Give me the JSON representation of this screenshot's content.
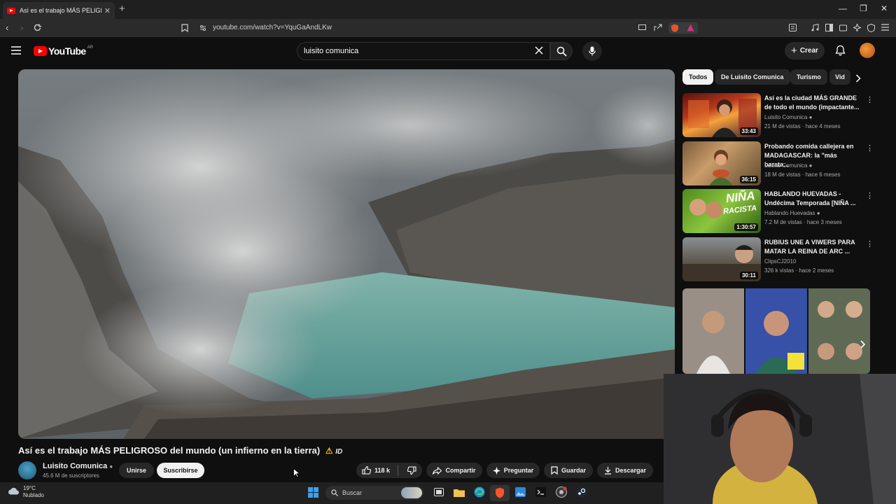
{
  "browser": {
    "tab_title": "Así es el trabajo MÁS PELIGR",
    "url": "youtube.com/watch?v=YquGaAndLKw"
  },
  "youtube": {
    "logo_text": "YouTube",
    "country_code": "AR",
    "search_value": "luisito comunica",
    "create_label": "Crear"
  },
  "video": {
    "title": "Así es el trabajo MÁS PELIGROSO del mundo (un infierno en la tierra)",
    "title_suffix": "ID",
    "channel": "Luisito Comunica",
    "subscribers": "45.6 M de suscriptores",
    "join_label": "Unirse",
    "subscribe_label": "Suscribirse",
    "likes": "118 k",
    "share_label": "Compartir",
    "ask_label": "Preguntar",
    "save_label": "Guardar",
    "download_label": "Descargar"
  },
  "chips": [
    "Todos",
    "De Luisito Comunica",
    "Turismo",
    "Vid"
  ],
  "recommendations": [
    {
      "title": "Así es la ciudad MÁS GRANDE de todo el mundo (impactante...",
      "channel": "Luisito Comunica",
      "meta": "21 M de vistas · hace 4 meses",
      "duration": "33:43",
      "verified": true
    },
    {
      "title": "Probando comida callejera en MADAGASCAR: la \"más barata...",
      "channel": "Luisito Comunica",
      "meta": "18 M de vistas · hace 6 meses",
      "duration": "36:15",
      "verified": true
    },
    {
      "title": "HABLANDO HUEVADAS - Undécima Temporada [NIÑA ...",
      "channel": "Hablando Huevadas",
      "meta": "7.2 M de vistas · hace 3 meses",
      "duration": "1:30:57",
      "verified": true
    },
    {
      "title": "RUBIUS UNE A VIWERS PARA MATAR LA REINA DE ARC ...",
      "channel": "ClipsCJ2010",
      "meta": "326 k vistas · hace 2 meses",
      "duration": "30:11",
      "verified": false
    }
  ],
  "thumb_text": {
    "nina_line1": "NIÑA",
    "nina_line2": "RACISTA"
  },
  "taskbar": {
    "temperature": "19°C",
    "weather": "Nublado",
    "search_label": "Buscar"
  }
}
